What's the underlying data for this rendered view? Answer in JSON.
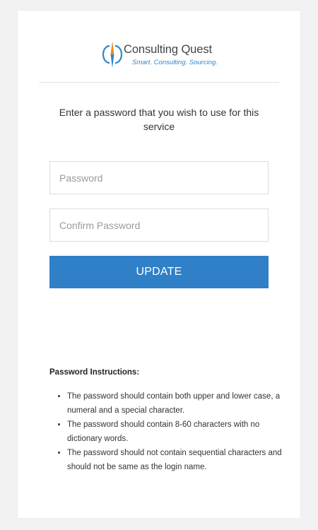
{
  "brand": {
    "name": "Consulting Quest",
    "tagline": "Smart. Consulting. Sourcing.",
    "colors": {
      "accent_blue": "#2f86c9",
      "accent_orange": "#e58a2e",
      "text_dark": "#444444"
    }
  },
  "form": {
    "intro_text": "Enter a password that you wish to use for this service",
    "password_placeholder": "Password",
    "confirm_placeholder": "Confirm Password",
    "password_value": "",
    "confirm_value": "",
    "update_label": "UPDATE",
    "button_color": "#3080c8"
  },
  "instructions": {
    "title": "Password Instructions:",
    "items": [
      "The password should contain both upper and lower case, a numeral and a special character.",
      "The password should contain 8-60 characters with no dictionary words.",
      "The password should not contain sequential characters and should not be same as the login name."
    ]
  }
}
